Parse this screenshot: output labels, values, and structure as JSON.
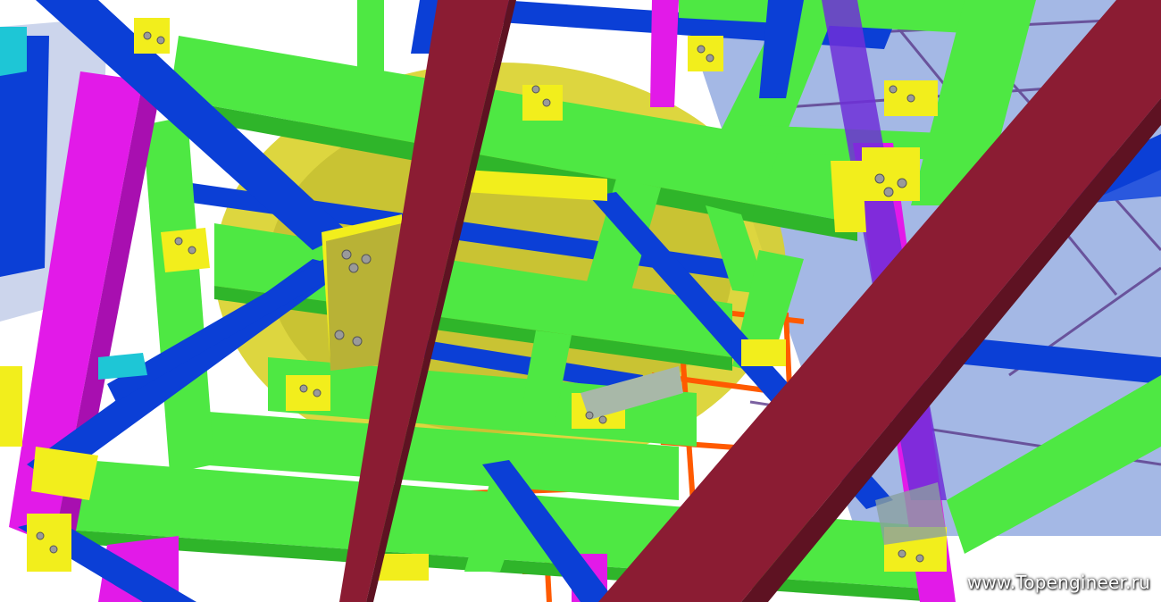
{
  "image": {
    "subject": "3D steel frame structure viewed from below",
    "watermark": "www.Topengineer.ru"
  },
  "colors": {
    "sky": "#ffffff",
    "beam_green": "#4ee843",
    "beam_green_dark": "#2fb52a",
    "beam_blue": "#0b3fd6",
    "beam_blue_dark": "#072a9a",
    "column_magenta": "#e21ae8",
    "rafter_maroon": "#8b1c33",
    "plate_yellow": "#f2ee1c",
    "plate_olive": "#b8b236",
    "pipe_orange": "#ff5a00",
    "bolt_grey": "#9a9a9a",
    "cyan_beam": "#1ec6d6"
  }
}
